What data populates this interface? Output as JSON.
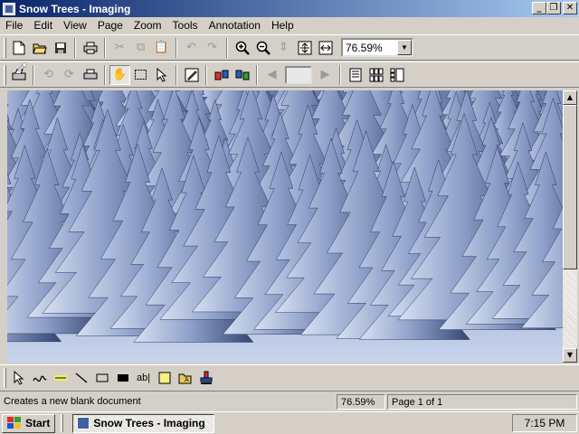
{
  "window": {
    "title": "Snow Trees - Imaging"
  },
  "menubar": [
    "File",
    "Edit",
    "View",
    "Page",
    "Zoom",
    "Tools",
    "Annotation",
    "Help"
  ],
  "toolbar1": {
    "zoom_value": "76.59%"
  },
  "toolbar2": {
    "page_input": ""
  },
  "status": {
    "message": "Creates a new blank document",
    "zoom": "76.59%",
    "page": "Page 1 of 1"
  },
  "taskbar": {
    "start": "Start",
    "task": "Snow Trees - Imaging",
    "clock": "7:15 PM"
  },
  "colors": {
    "title_start": "#0a246a",
    "title_end": "#a6caf0",
    "chrome": "#d4d0c8",
    "snow": "#dfe8f8",
    "tree": "#3a4a75"
  },
  "icons": [
    "new-document-icon",
    "open-folder-icon",
    "save-icon",
    "print-icon",
    "cut-icon",
    "copy-icon",
    "paste-icon",
    "undo-icon",
    "redo-icon",
    "zoom-in-icon",
    "zoom-out-icon",
    "best-fit-icon",
    "fit-to-height-icon",
    "fit-to-width-icon",
    "scan-icon",
    "rotate-left-icon",
    "rotate-right-icon",
    "hand-icon",
    "select-image-icon",
    "select-annotation-icon",
    "annotation-toolbar-icon",
    "previous-page-icon",
    "next-page-icon",
    "one-page-icon",
    "thumbnail-icon",
    "page-thumbnail-icon",
    "freehand-line-icon",
    "highlighter-icon",
    "straight-line-icon",
    "hollow-rect-icon",
    "filled-rect-icon",
    "text-icon",
    "note-icon",
    "text-from-file-icon",
    "rubber-stamp-icon"
  ]
}
